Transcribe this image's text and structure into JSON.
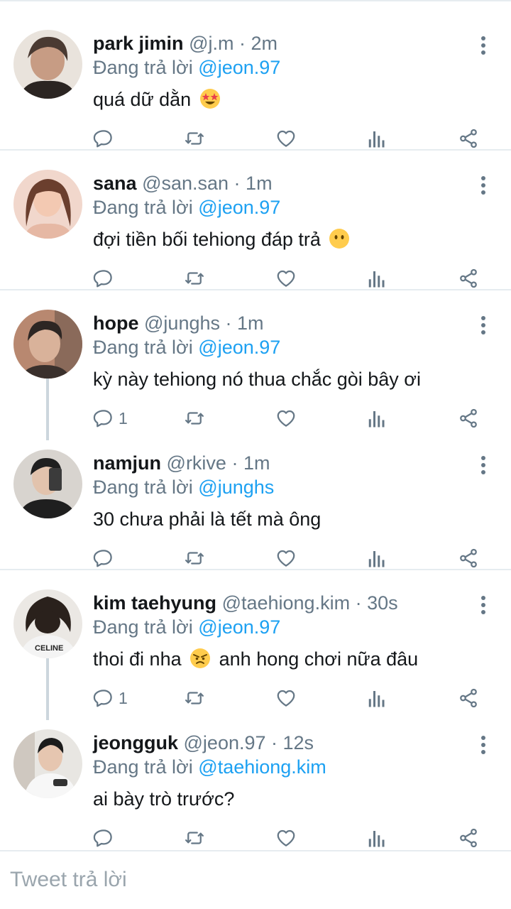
{
  "tweets": [
    {
      "name": "park jimin",
      "handle": "@j.m",
      "time": "2m",
      "replying_prefix": "Đang trả lời",
      "replying_to": "@jeon.97",
      "text_before": "quá dữ dằn",
      "emoji": "star-struck-emoji",
      "text_after": "",
      "reply_count": "",
      "avatar_colors": [
        "#4a3a32",
        "#e9e3dc"
      ]
    },
    {
      "name": "sana",
      "handle": "@san.san",
      "time": "1m",
      "replying_prefix": "Đang trả lời",
      "replying_to": "@jeon.97",
      "text_before": "đợi tiền bối tehiong đáp trả",
      "emoji": "no-mouth-emoji",
      "text_after": "",
      "reply_count": "",
      "avatar_colors": [
        "#6b3f2e",
        "#f1d7cc"
      ]
    },
    {
      "name": "hope",
      "handle": "@junghs",
      "time": "1m",
      "replying_prefix": "Đang trả lời",
      "replying_to": "@jeon.97",
      "text_before": "kỳ này tehiong nó thua chắc gòi bây ơi",
      "emoji": "",
      "text_after": "",
      "reply_count": "1",
      "avatar_colors": [
        "#2d2623",
        "#b88870"
      ]
    },
    {
      "name": "namjun",
      "handle": "@rkive",
      "time": "1m",
      "replying_prefix": "Đang trả lời",
      "replying_to": "@junghs",
      "text_before": "30 chưa phải là tết mà ông",
      "emoji": "",
      "text_after": "",
      "reply_count": "",
      "avatar_colors": [
        "#1f1f1f",
        "#d8d4cf"
      ]
    },
    {
      "name": "kim taehyung",
      "handle": "@taehiong.kim",
      "time": "30s",
      "replying_prefix": "Đang trả lời",
      "replying_to": "@jeon.97",
      "text_before": "thoi đi nha",
      "emoji": "angry-emoji",
      "text_after": "anh hong chơi nữa đâu",
      "reply_count": "1",
      "avatar_colors": [
        "#2a211c",
        "#f4f4f4"
      ]
    },
    {
      "name": "jeongguk",
      "handle": "@jeon.97",
      "time": "12s",
      "replying_prefix": "Đang trả lời",
      "replying_to": "@taehiong.kim",
      "text_before": "ai bày trò trước?",
      "emoji": "",
      "text_after": "",
      "reply_count": "",
      "avatar_colors": [
        "#1c1c1c",
        "#e8e6e2"
      ]
    }
  ],
  "compose": {
    "placeholder": "Tweet trả lời"
  },
  "icons": {
    "reply": "reply-icon",
    "retweet": "retweet-icon",
    "like": "heart-icon",
    "stats": "analytics-icon",
    "share": "share-icon",
    "more": "more-vertical-icon"
  },
  "colors": {
    "accent": "#1da1f2",
    "muted": "#657786",
    "icon": "#657786",
    "divider": "#e6ecf0"
  }
}
